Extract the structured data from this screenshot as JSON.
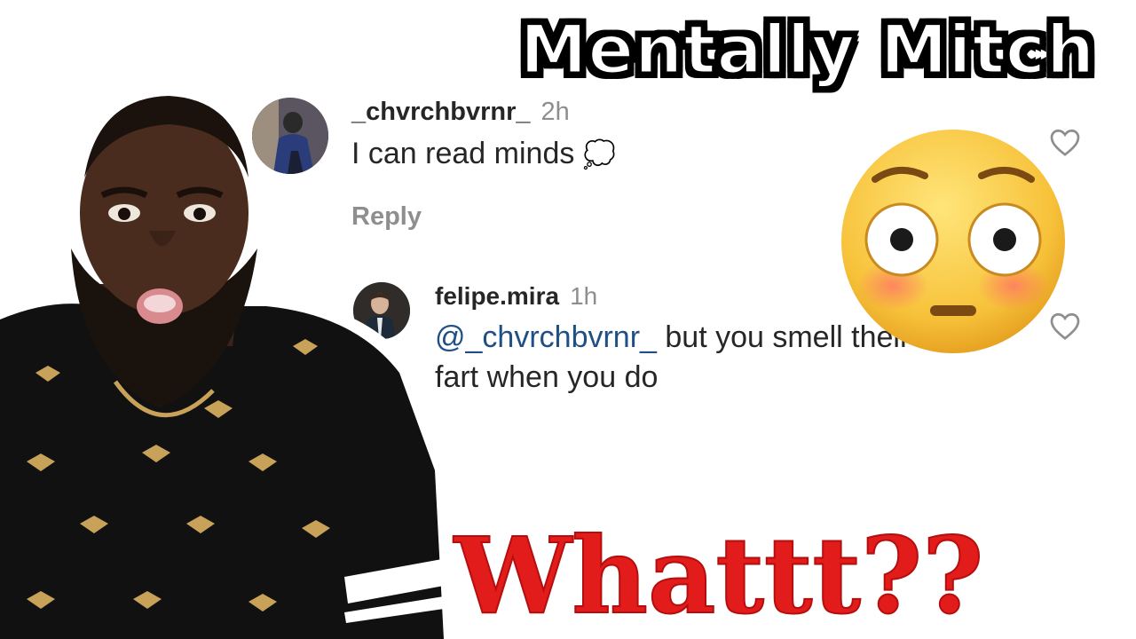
{
  "title_top": "Mentally Mitch",
  "title_bottom": "Whattt??",
  "comments": [
    {
      "username": "_chvrchbvrnr_",
      "time": "2h",
      "text": "I can read minds",
      "emoji": "💭",
      "reply_label": "Reply"
    },
    {
      "username": "felipe.mira",
      "time": "1h",
      "mention": "@_chvrchbvrnr_",
      "text_line1": " but you smell their",
      "text_line2": "fart when you do"
    }
  ],
  "icons": {
    "like": "heart-outline-icon",
    "reaction": "flushed-face-emoji"
  },
  "colors": {
    "mention": "#1f4f84",
    "title_bottom": "#e21b1b",
    "secondary_text": "#8e8e8e"
  }
}
